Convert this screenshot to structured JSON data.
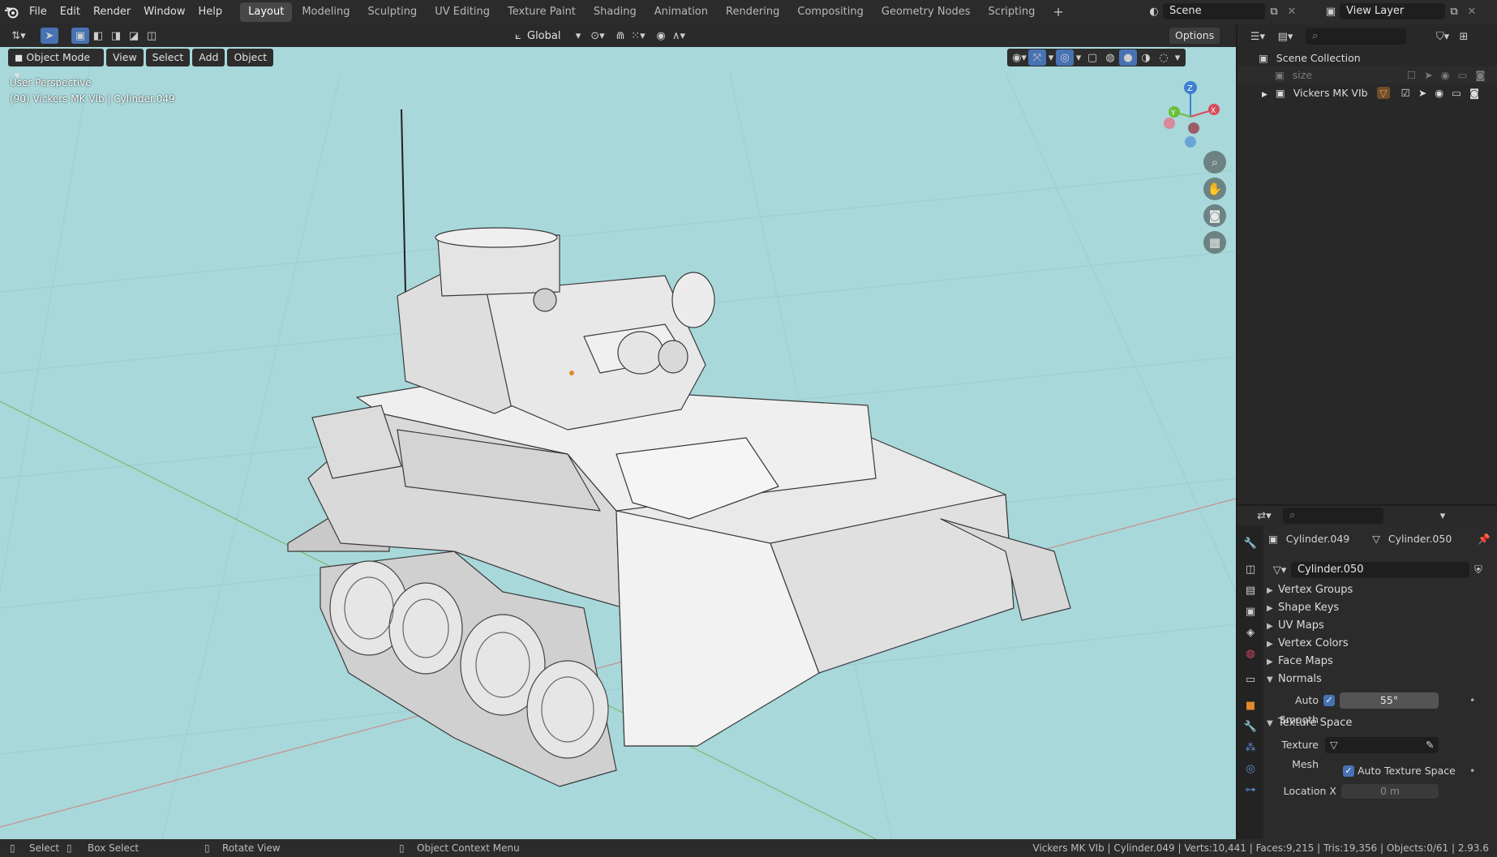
{
  "topbar": {
    "menus": [
      "File",
      "Edit",
      "Render",
      "Window",
      "Help"
    ],
    "workspaces": [
      "Layout",
      "Modeling",
      "Sculpting",
      "UV Editing",
      "Texture Paint",
      "Shading",
      "Animation",
      "Rendering",
      "Compositing",
      "Geometry Nodes",
      "Scripting"
    ],
    "active_workspace": "Layout",
    "add_tab": "+",
    "scene_name": "Scene",
    "view_layer_name": "View Layer"
  },
  "viewport": {
    "transform_orientation": "Global",
    "options_label": "Options",
    "mode": "Object Mode",
    "menu_view": "View",
    "menu_select": "Select",
    "menu_add": "Add",
    "menu_object": "Object",
    "perspective_label": "User Perspective",
    "object_info": "(90) Vickers MK VIb | Cylinder.049",
    "gizmo": {
      "z": "Z",
      "y": "Y",
      "x": "X"
    },
    "background_color": "#a8d8da"
  },
  "outliner": {
    "root": "Scene Collection",
    "items": [
      {
        "label": "size",
        "dim": true
      },
      {
        "label": "Vickers MK VIb",
        "dim": false
      }
    ]
  },
  "properties": {
    "object_name": "Cylinder.049",
    "mesh_name": "Cylinder.050",
    "data_field": "Cylinder.050",
    "sections": [
      {
        "label": "Vertex Groups",
        "expanded": false
      },
      {
        "label": "Shape Keys",
        "expanded": false
      },
      {
        "label": "UV Maps",
        "expanded": false
      },
      {
        "label": "Vertex Colors",
        "expanded": false
      },
      {
        "label": "Face Maps",
        "expanded": false
      },
      {
        "label": "Normals",
        "expanded": true
      }
    ],
    "auto_smooth_label": "Auto Smooth",
    "auto_smooth_angle": "55°",
    "texture_space_label": "Texture Space",
    "texture_mesh_label": "Texture Mesh",
    "auto_texture_space_label": "Auto Texture Space",
    "location_x_label": "Location X",
    "location_x_value": "0 m"
  },
  "statusbar": {
    "select": "Select",
    "box_select": "Box Select",
    "rotate_view": "Rotate View",
    "context_menu": "Object Context Menu",
    "stats": "Vickers MK VIb | Cylinder.049 | Verts:10,441 | Faces:9,215 | Tris:19,356 | Objects:0/61 | 2.93.6"
  },
  "colors": {
    "accent": "#4772b3",
    "active_object": "#e08a2a"
  }
}
